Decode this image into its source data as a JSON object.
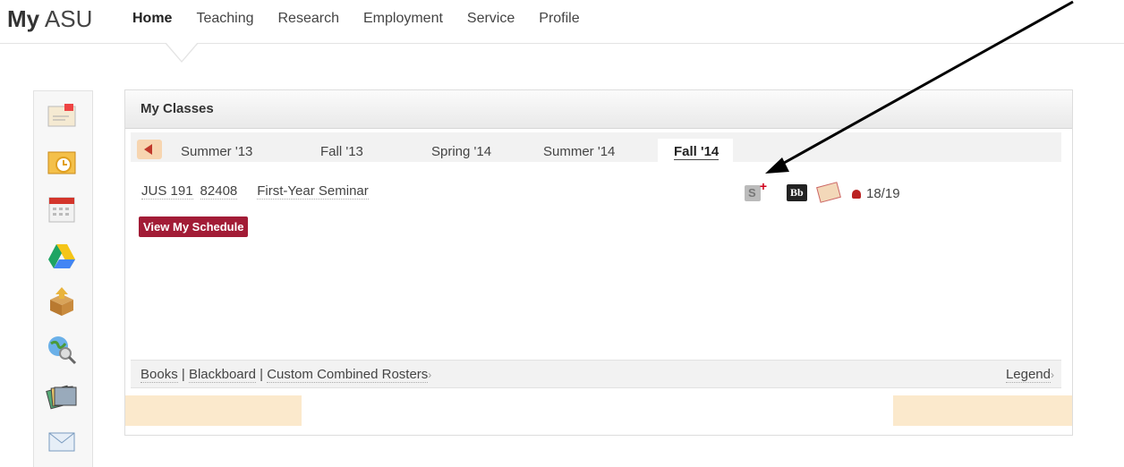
{
  "logo": {
    "my": "My",
    "asu": "ASU"
  },
  "nav": [
    {
      "label": "Home",
      "active": true
    },
    {
      "label": "Teaching"
    },
    {
      "label": "Research"
    },
    {
      "label": "Employment"
    },
    {
      "label": "Service"
    },
    {
      "label": "Profile"
    }
  ],
  "dock_icons": [
    "email-icon",
    "outlook-icon",
    "calendar-icon",
    "google-drive-icon",
    "package-icon",
    "globe-search-icon",
    "cards-icon",
    "mail-icon"
  ],
  "panel": {
    "title": "My Classes",
    "terms": [
      "Summer '13",
      "Fall '13",
      "Spring '14",
      "Summer '14"
    ],
    "selected_term": "Fall '14",
    "class": {
      "course": "JUS 191",
      "section": "82408",
      "name": "First-Year Seminar",
      "enrollment": "18/19"
    },
    "schedule_button": "View My Schedule",
    "footer": {
      "books": "Books",
      "sep": " | ",
      "blackboard": "Blackboard",
      "rosters": "Custom Combined Rosters",
      "legend": "Legend"
    },
    "icons": {
      "schedule": "s-plus-icon",
      "blackboard": "Bb",
      "envelope": "envelope-icon",
      "person": "person-icon"
    }
  },
  "colors": {
    "brand": "#a21c36",
    "band": "#fbe9cc"
  }
}
